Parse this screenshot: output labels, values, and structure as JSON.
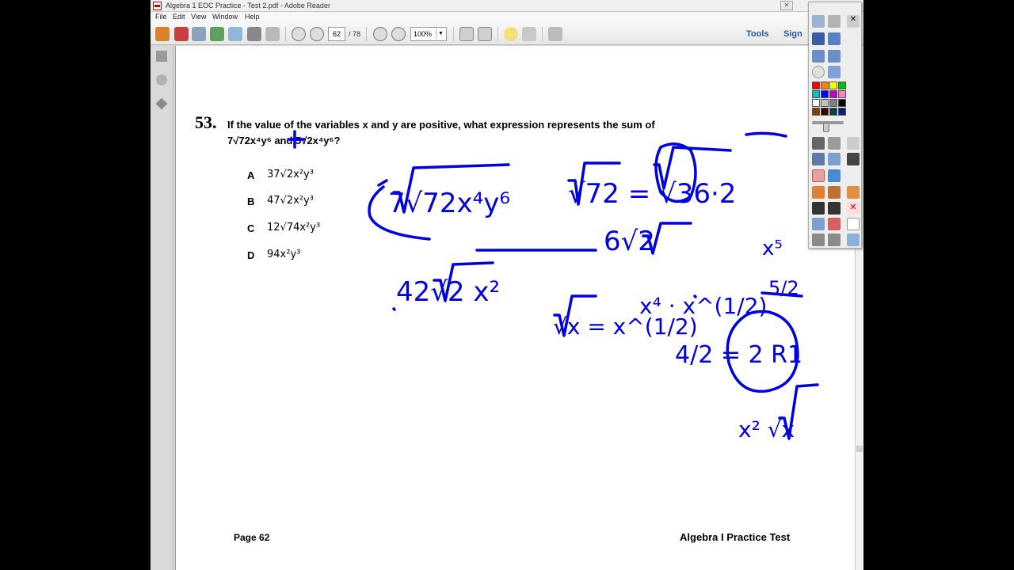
{
  "window": {
    "title": "Algebra 1 EOC Practice - Test 2.pdf - Adobe Reader"
  },
  "menu": [
    "File",
    "Edit",
    "View",
    "Window",
    "Help"
  ],
  "toolbar": {
    "page_current": "62",
    "page_total": "/ 78",
    "zoom": "100%",
    "tools_label": "Tools",
    "sign_label": "Sign"
  },
  "question": {
    "number": "53.",
    "line1": "If the value of the variables x and y are positive, what expression represents the sum of",
    "line2": "7√72x⁴y⁶ and 5√2x⁴y⁶?",
    "choices": [
      {
        "letter": "A",
        "text": "37√2x²y³"
      },
      {
        "letter": "B",
        "text": "47√2x²y³"
      },
      {
        "letter": "C",
        "text": "12√74x²y³"
      },
      {
        "letter": "D",
        "text": "94x²y³"
      }
    ]
  },
  "footer": {
    "page_label": "Page 62",
    "test_name": "Algebra I Practice Test"
  },
  "annotations": [
    "7√72x⁴y⁶",
    "√72 = √36·2",
    "6√2",
    "42√2 x²",
    "√x = x^(1/2)",
    "x⁴ · x^(1/2)",
    "4/2 = 2 R1",
    "x² √x",
    "x⁵",
    "5/2"
  ],
  "palette": {
    "colors": [
      "#ff0000",
      "#ff8000",
      "#ffff00",
      "#00c000",
      "#00c0c0",
      "#0000ff",
      "#c000c0",
      "#ff80c0",
      "#ffffff",
      "#c0c0c0",
      "#808080",
      "#000000",
      "#804000",
      "#400000",
      "#004040",
      "#002080"
    ]
  },
  "ink_color": "#0000e0"
}
